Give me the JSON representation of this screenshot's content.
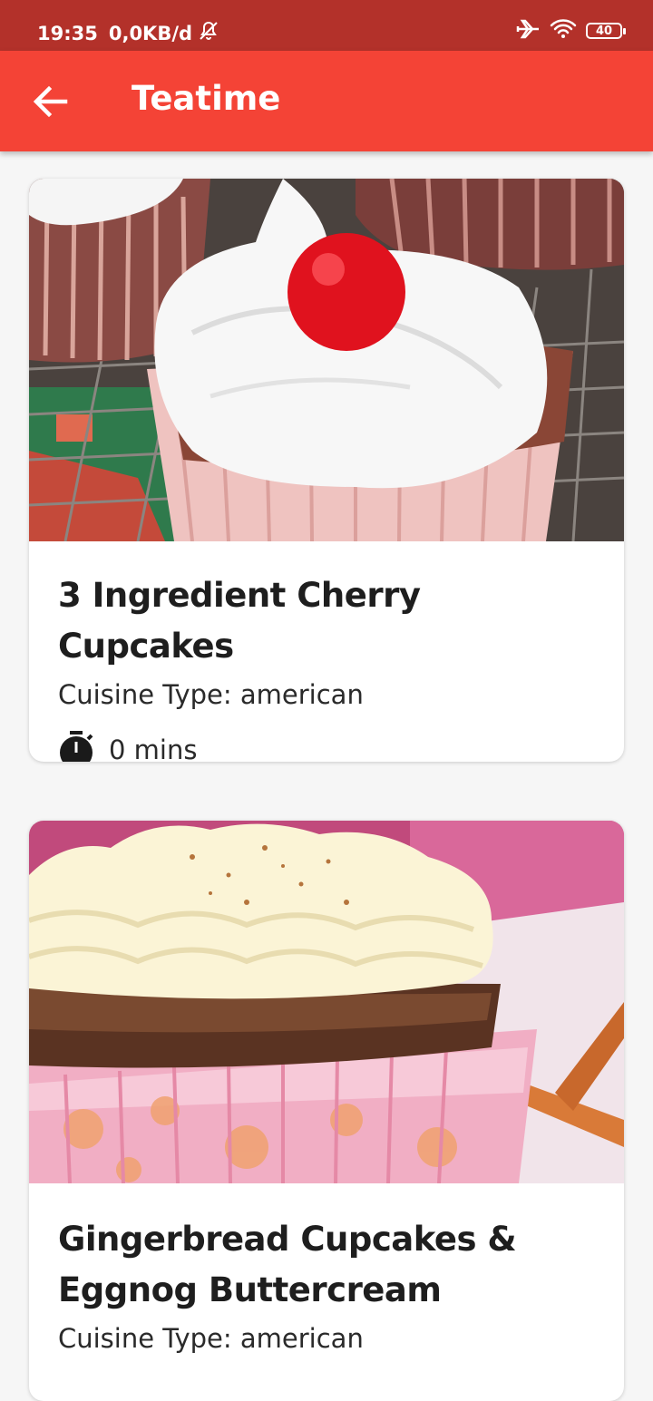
{
  "status_bar": {
    "time": "19:35",
    "network_speed": "0,0KB/d",
    "battery_level": "40",
    "icons": [
      "mute-bell-icon",
      "airplane-icon",
      "wifi-icon",
      "battery-icon"
    ]
  },
  "app_bar": {
    "title": "Teatime",
    "back_icon": "arrow-left-icon"
  },
  "colors": {
    "app_bar": "#f44336",
    "status_bar": "#b3312a",
    "background": "#f6f6f6",
    "card": "#ffffff"
  },
  "recipes": [
    {
      "title": "3 Ingredient Cherry Cupcakes",
      "cuisine": "Cuisine Type: american",
      "time": "0 mins",
      "time_icon": "timer-icon"
    },
    {
      "title": "Gingerbread Cupcakes & Eggnog Buttercream",
      "cuisine": "Cuisine Type: american"
    }
  ]
}
